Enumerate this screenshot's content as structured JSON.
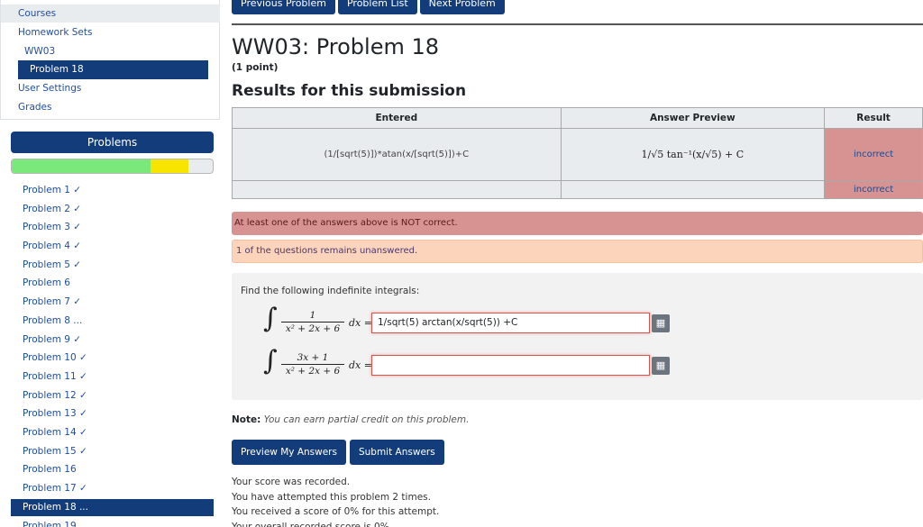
{
  "sidebar": {
    "nav": {
      "courses": "Courses",
      "homework_sets": "Homework Sets",
      "set": "WW03",
      "problem": "Problem 18",
      "user_settings": "User Settings",
      "grades": "Grades"
    },
    "problems_header": "Problems",
    "progress": {
      "correct_fraction": 0.69,
      "partial_fraction": 0.19
    },
    "problems": [
      "Problem 1 ✓",
      "Problem 2 ✓",
      "Problem 3 ✓",
      "Problem 4 ✓",
      "Problem 5 ✓",
      "Problem 6",
      "Problem 7 ✓",
      "Problem 8 ...",
      "Problem 9 ✓",
      "Problem 10 ✓",
      "Problem 11 ✓",
      "Problem 12 ✓",
      "Problem 13 ✓",
      "Problem 14 ✓",
      "Problem 15 ✓",
      "Problem 16",
      "Problem 17 ✓",
      "Problem 18 ...",
      "Problem 19"
    ],
    "active_index": 17
  },
  "topbar": {
    "previous": "Previous Problem",
    "list": "Problem List",
    "next": "Next Problem"
  },
  "page": {
    "title": "WW03: Problem 18",
    "points": "(1 point)",
    "results_heading": "Results for this submission"
  },
  "results_table": {
    "headers": [
      "Entered",
      "Answer Preview",
      "Result"
    ],
    "rows": [
      {
        "entered": "(1/[sqrt(5)])*atan(x/[sqrt(5)])+C",
        "preview": "1/√5 tan⁻¹(x/√5) + C",
        "result": "incorrect"
      },
      {
        "entered": "",
        "preview": "",
        "result": "incorrect"
      }
    ]
  },
  "alerts": {
    "error": "At least one of the answers above is NOT correct.",
    "warning": "1 of the questions remains unanswered."
  },
  "problem": {
    "prompt": "Find the following indefinite integrals:",
    "integral1": {
      "num": "1",
      "den": "x² + 2x + 6",
      "dx": "dx ="
    },
    "integral2": {
      "num": "3x + 1",
      "den": "x² + 2x + 6",
      "dx": "dx ="
    },
    "answer1": "1/sqrt(5) arctan(x/sqrt(5)) +C",
    "answer2": ""
  },
  "note": {
    "label": "Note:",
    "text": "You can earn partial credit on this problem."
  },
  "actions": {
    "preview": "Preview My Answers",
    "submit": "Submit Answers"
  },
  "score": {
    "recorded": "Your score was recorded.",
    "attempts": "You have attempted this problem 2 times.",
    "received": "You received a score of 0% for this attempt.",
    "overall": "Your overall recorded score is 0%."
  }
}
